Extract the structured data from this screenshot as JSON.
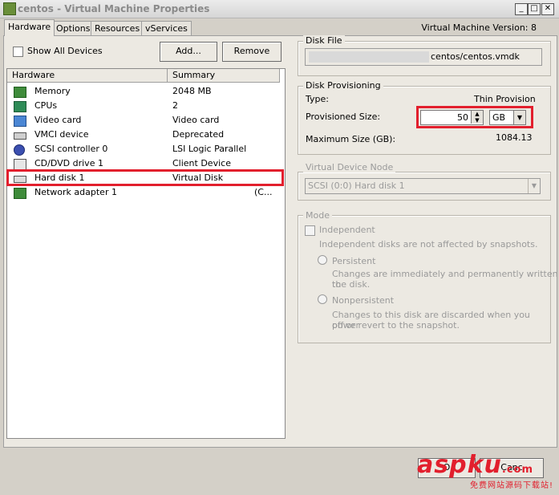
{
  "window": {
    "title": "centos - Virtual Machine Properties"
  },
  "tabs": [
    {
      "label": "Hardware"
    },
    {
      "label": "Options"
    },
    {
      "label": "Resources"
    },
    {
      "label": "vServices"
    }
  ],
  "vm_version": "Virtual Machine Version: 8",
  "show_all_devices": {
    "label": "Show All Devices",
    "checked": false
  },
  "buttons": {
    "add": "Add...",
    "remove": "Remove"
  },
  "hardware_list": {
    "headers": [
      "Hardware",
      "Summary"
    ],
    "rows": [
      {
        "name": "Memory",
        "summary": "2048 MB",
        "icon": "memory-icon"
      },
      {
        "name": "CPUs",
        "summary": "2",
        "icon": "cpu-icon"
      },
      {
        "name": "Video card",
        "summary": "Video card",
        "icon": "monitor-icon"
      },
      {
        "name": "VMCI device",
        "summary": "Deprecated",
        "icon": "vmci-icon"
      },
      {
        "name": "SCSI controller 0",
        "summary": "LSI Logic Parallel",
        "icon": "scsi-icon"
      },
      {
        "name": "CD/DVD drive 1",
        "summary": "Client Device",
        "icon": "cdrom-icon"
      },
      {
        "name": "Hard disk 1",
        "summary": "Virtual Disk",
        "icon": "harddisk-icon",
        "selected": true
      },
      {
        "name": "Network adapter 1",
        "summary": "(C...",
        "icon": "network-icon"
      }
    ]
  },
  "disk_file": {
    "label": "Disk File",
    "value": "centos/centos.vmdk"
  },
  "disk_provisioning": {
    "label": "Disk Provisioning",
    "type_label": "Type:",
    "type_value": "Thin Provision",
    "size_label": "Provisioned Size:",
    "size_value": "50",
    "size_unit": "GB",
    "max_label": "Maximum Size (GB):",
    "max_value": "1084.13"
  },
  "virtual_device_node": {
    "label": "Virtual Device Node",
    "value": "SCSI (0:0) Hard disk 1"
  },
  "mode": {
    "label": "Mode",
    "independent_label": "Independent",
    "independent_desc": "Independent disks are not affected by snapshots.",
    "persistent_label": "Persistent",
    "persistent_desc1": "Changes are immediately and permanently written to",
    "persistent_desc2": "the disk.",
    "nonpersistent_label": "Nonpersistent",
    "nonpersistent_desc1": "Changes to this disk are discarded when you power",
    "nonpersistent_desc2": "off or revert to the snapshot."
  },
  "footer": {
    "ok": "O",
    "cancel": "Canc"
  },
  "watermark": {
    "logo": "aspku",
    "com": ".com",
    "sub": "免费网站源码下载站!"
  },
  "colors": {
    "highlight": "#e21f2d",
    "panel": "#ece9e2",
    "window": "#d4d0c8"
  }
}
